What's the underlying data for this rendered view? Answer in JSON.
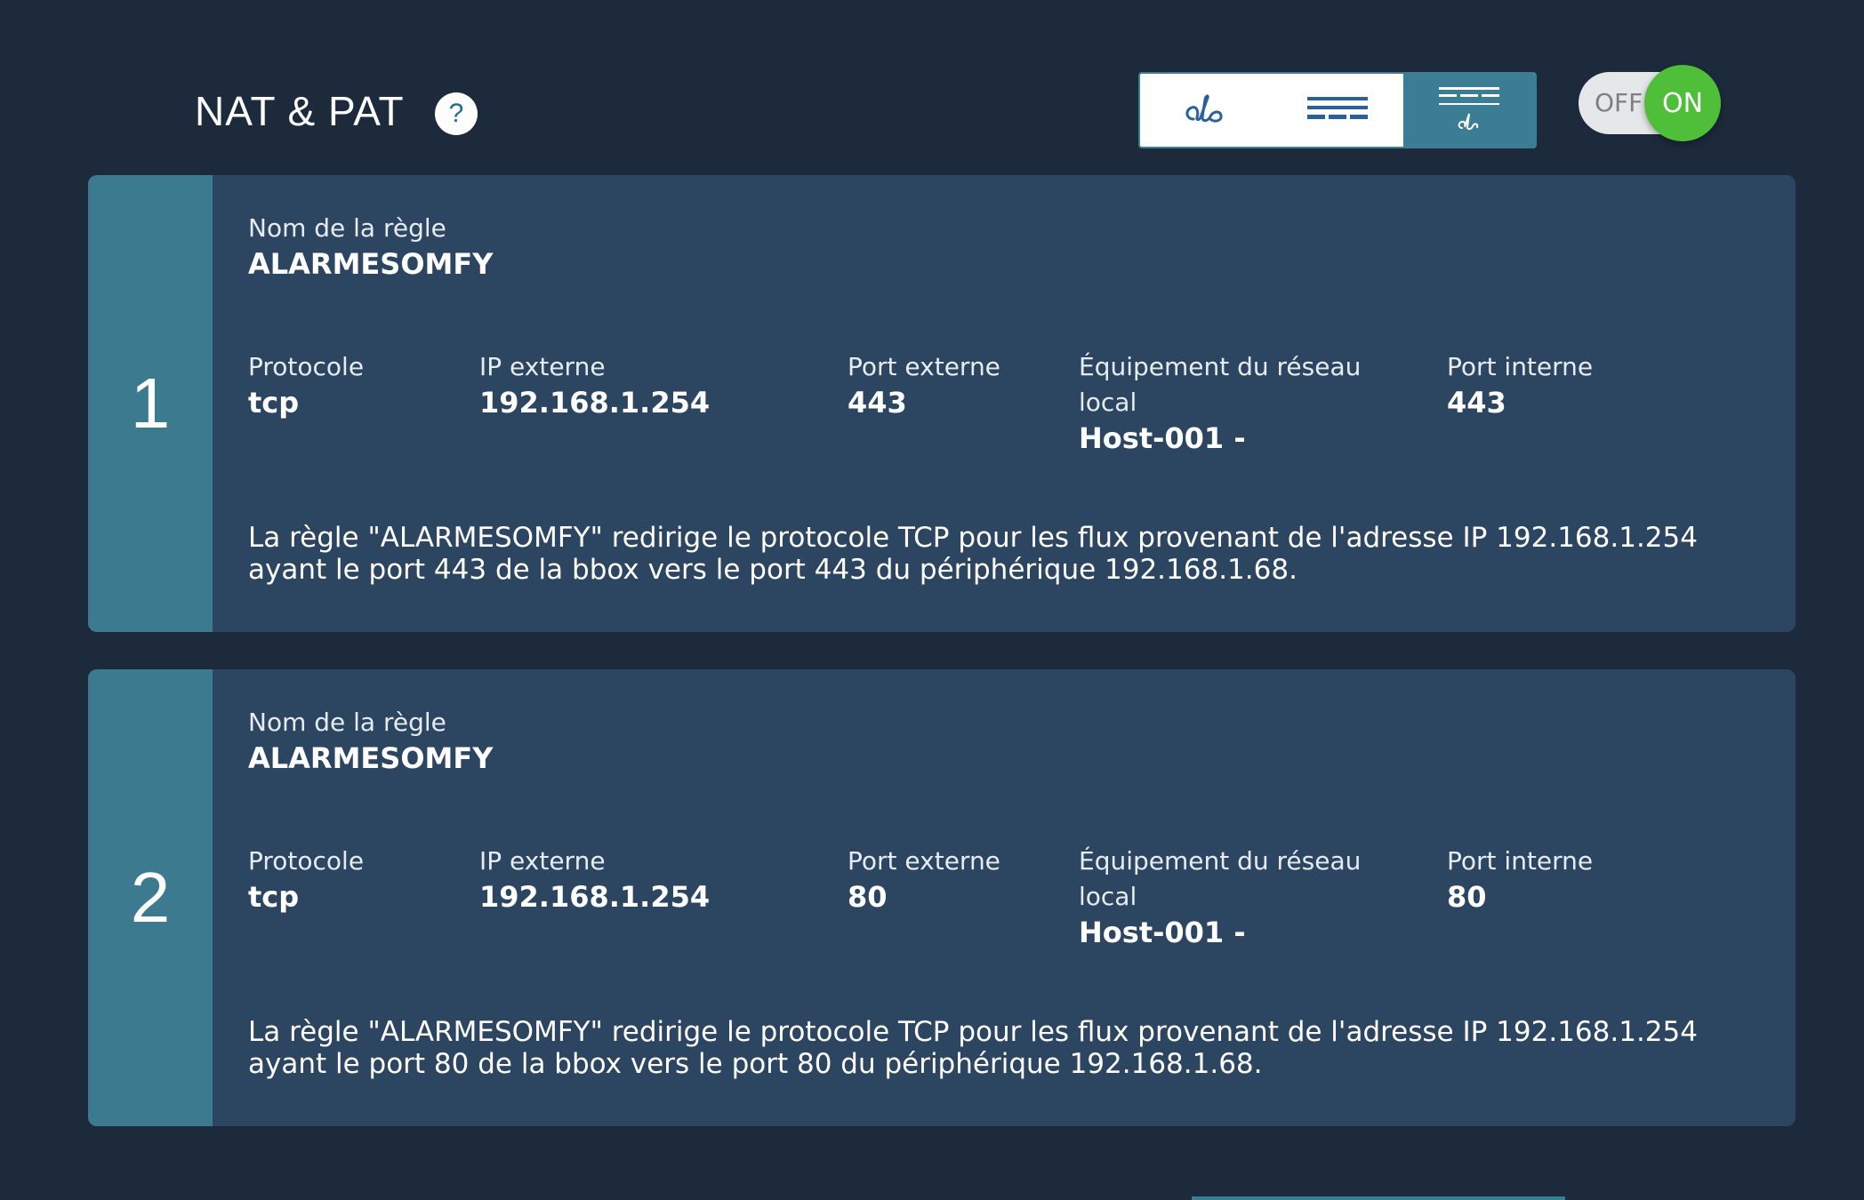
{
  "header": {
    "title": "NAT & PAT",
    "help_label": "?",
    "view_modes": [
      {
        "icon": "handwriting-icon",
        "active": false
      },
      {
        "icon": "list-lines-icon",
        "active": false
      },
      {
        "icon": "list-with-text-icon",
        "active": true
      }
    ],
    "master_toggle": {
      "off_label": "OFF",
      "on_label": "ON",
      "state": "on"
    }
  },
  "labels": {
    "rule_name": "Nom de la règle",
    "protocol": "Protocole",
    "external_ip": "IP externe",
    "external_port": "Port externe",
    "local_device": "Équipement du réseau local",
    "internal_port": "Port interne"
  },
  "rules": [
    {
      "index": "1",
      "name": "ALARMESOMFY",
      "protocol": "tcp",
      "external_ip": "192.168.1.254",
      "external_port": "443",
      "local_device": "Host-001 -",
      "internal_port": "443",
      "enabled": true,
      "description": "La règle \"ALARMESOMFY\" redirige le protocole TCP pour les flux provenant de l'adresse IP 192.168.1.254 ayant le port 443 de la bbox vers le port 443 du périphérique 192.168.1.68."
    },
    {
      "index": "2",
      "name": "ALARMESOMFY",
      "protocol": "tcp",
      "external_ip": "192.168.1.254",
      "external_port": "80",
      "local_device": "Host-001 -",
      "internal_port": "80",
      "enabled": true,
      "description": "La règle \"ALARMESOMFY\" redirige le protocole TCP pour les flux provenant de l'adresse IP 192.168.1.254 ayant le port 80 de la bbox vers le port 80 du périphérique 192.168.1.68."
    }
  ],
  "colors": {
    "background": "#1d2a3b",
    "card": "#2c4560",
    "index_band": "#3b7a8f",
    "toggle_on": "#4fbf3a"
  }
}
